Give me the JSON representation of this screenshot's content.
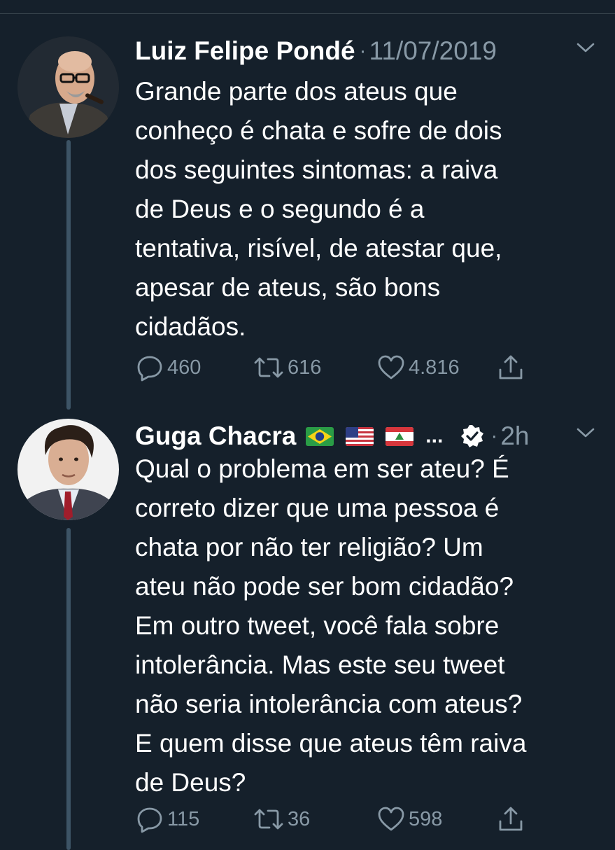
{
  "tweets": [
    {
      "author_name": "Luiz Felipe Pondé",
      "separator": "·",
      "date": "11/07/2019",
      "text_lines": [
        "Grande parte dos ateus que",
        "conheço é chata e sofre de dois",
        "dos seguintes sintomas: a raiva",
        "de Deus e o segundo é a",
        "tentativa, risível, de atestar que,",
        "apesar de ateus, são bons",
        "cidadãos."
      ],
      "replies": "460",
      "retweets": "616",
      "likes": "4.816"
    },
    {
      "author_name": "Guga Chacra",
      "author_flags": [
        "brazil-flag",
        "usa-flag",
        "lebanon-flag"
      ],
      "name_truncation": "...",
      "verified": true,
      "separator": "·",
      "date": "2h",
      "text_lines": [
        "Qual o problema em ser ateu? É",
        "correto dizer que uma pessoa é",
        "chata por não ter religião? Um",
        "ateu não pode ser bom cidadão?",
        "Em outro tweet, você fala sobre",
        "intolerância. Mas este seu tweet",
        "não seria intolerância com ateus?",
        "E quem disse que ateus têm raiva",
        "de Deus?"
      ],
      "replies": "115",
      "retweets": "36",
      "likes": "598"
    }
  ],
  "colors": {
    "background": "#15202b",
    "text": "#ffffff",
    "muted": "#8899a6",
    "thread_line": "#3d5466"
  }
}
